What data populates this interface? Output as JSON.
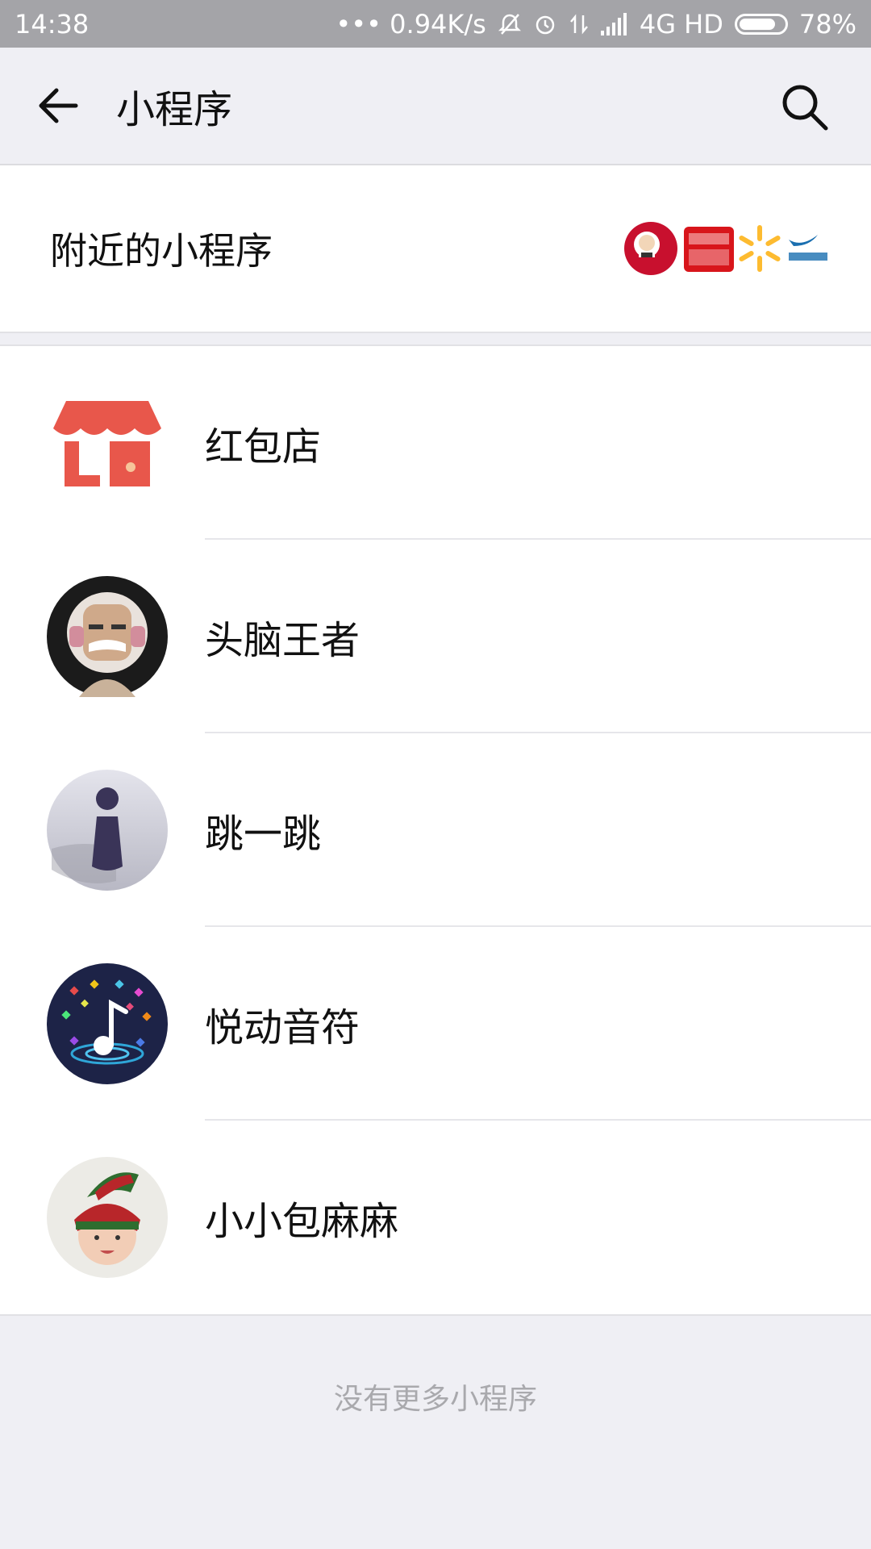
{
  "status_bar": {
    "time": "14:38",
    "network_speed": "••• 0.94K/s",
    "network": "4G HD",
    "battery": "78%",
    "battery_level": 0.78
  },
  "header": {
    "title": "小程序",
    "back_icon": "arrow-left-icon",
    "search_icon": "search-icon"
  },
  "nearby": {
    "label": "附近的小程序"
  },
  "mini_programs": [
    {
      "name": "红包店",
      "icon": "shop-icon"
    },
    {
      "name": "头脑王者",
      "icon": "old-man-avatar-icon"
    },
    {
      "name": "跳一跳",
      "icon": "jump-piece-icon"
    },
    {
      "name": "悦动音符",
      "icon": "music-note-icon"
    },
    {
      "name": "小小包麻麻",
      "icon": "baby-photo-icon"
    }
  ],
  "footer": {
    "text": "没有更多小程序"
  },
  "colors": {
    "background": "#efeff4",
    "shop_red": "#e8574b",
    "status_bar": "#a4a4a8"
  }
}
